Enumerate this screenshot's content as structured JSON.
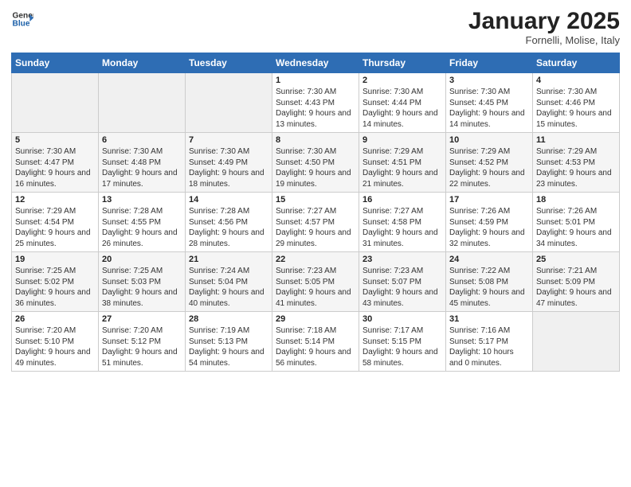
{
  "logo": {
    "line1": "General",
    "line2": "Blue"
  },
  "title": "January 2025",
  "location": "Fornelli, Molise, Italy",
  "days_of_week": [
    "Sunday",
    "Monday",
    "Tuesday",
    "Wednesday",
    "Thursday",
    "Friday",
    "Saturday"
  ],
  "weeks": [
    [
      {
        "day": "",
        "info": ""
      },
      {
        "day": "",
        "info": ""
      },
      {
        "day": "",
        "info": ""
      },
      {
        "day": "1",
        "info": "Sunrise: 7:30 AM\nSunset: 4:43 PM\nDaylight: 9 hours and 13 minutes."
      },
      {
        "day": "2",
        "info": "Sunrise: 7:30 AM\nSunset: 4:44 PM\nDaylight: 9 hours and 14 minutes."
      },
      {
        "day": "3",
        "info": "Sunrise: 7:30 AM\nSunset: 4:45 PM\nDaylight: 9 hours and 14 minutes."
      },
      {
        "day": "4",
        "info": "Sunrise: 7:30 AM\nSunset: 4:46 PM\nDaylight: 9 hours and 15 minutes."
      }
    ],
    [
      {
        "day": "5",
        "info": "Sunrise: 7:30 AM\nSunset: 4:47 PM\nDaylight: 9 hours and 16 minutes."
      },
      {
        "day": "6",
        "info": "Sunrise: 7:30 AM\nSunset: 4:48 PM\nDaylight: 9 hours and 17 minutes."
      },
      {
        "day": "7",
        "info": "Sunrise: 7:30 AM\nSunset: 4:49 PM\nDaylight: 9 hours and 18 minutes."
      },
      {
        "day": "8",
        "info": "Sunrise: 7:30 AM\nSunset: 4:50 PM\nDaylight: 9 hours and 19 minutes."
      },
      {
        "day": "9",
        "info": "Sunrise: 7:29 AM\nSunset: 4:51 PM\nDaylight: 9 hours and 21 minutes."
      },
      {
        "day": "10",
        "info": "Sunrise: 7:29 AM\nSunset: 4:52 PM\nDaylight: 9 hours and 22 minutes."
      },
      {
        "day": "11",
        "info": "Sunrise: 7:29 AM\nSunset: 4:53 PM\nDaylight: 9 hours and 23 minutes."
      }
    ],
    [
      {
        "day": "12",
        "info": "Sunrise: 7:29 AM\nSunset: 4:54 PM\nDaylight: 9 hours and 25 minutes."
      },
      {
        "day": "13",
        "info": "Sunrise: 7:28 AM\nSunset: 4:55 PM\nDaylight: 9 hours and 26 minutes."
      },
      {
        "day": "14",
        "info": "Sunrise: 7:28 AM\nSunset: 4:56 PM\nDaylight: 9 hours and 28 minutes."
      },
      {
        "day": "15",
        "info": "Sunrise: 7:27 AM\nSunset: 4:57 PM\nDaylight: 9 hours and 29 minutes."
      },
      {
        "day": "16",
        "info": "Sunrise: 7:27 AM\nSunset: 4:58 PM\nDaylight: 9 hours and 31 minutes."
      },
      {
        "day": "17",
        "info": "Sunrise: 7:26 AM\nSunset: 4:59 PM\nDaylight: 9 hours and 32 minutes."
      },
      {
        "day": "18",
        "info": "Sunrise: 7:26 AM\nSunset: 5:01 PM\nDaylight: 9 hours and 34 minutes."
      }
    ],
    [
      {
        "day": "19",
        "info": "Sunrise: 7:25 AM\nSunset: 5:02 PM\nDaylight: 9 hours and 36 minutes."
      },
      {
        "day": "20",
        "info": "Sunrise: 7:25 AM\nSunset: 5:03 PM\nDaylight: 9 hours and 38 minutes."
      },
      {
        "day": "21",
        "info": "Sunrise: 7:24 AM\nSunset: 5:04 PM\nDaylight: 9 hours and 40 minutes."
      },
      {
        "day": "22",
        "info": "Sunrise: 7:23 AM\nSunset: 5:05 PM\nDaylight: 9 hours and 41 minutes."
      },
      {
        "day": "23",
        "info": "Sunrise: 7:23 AM\nSunset: 5:07 PM\nDaylight: 9 hours and 43 minutes."
      },
      {
        "day": "24",
        "info": "Sunrise: 7:22 AM\nSunset: 5:08 PM\nDaylight: 9 hours and 45 minutes."
      },
      {
        "day": "25",
        "info": "Sunrise: 7:21 AM\nSunset: 5:09 PM\nDaylight: 9 hours and 47 minutes."
      }
    ],
    [
      {
        "day": "26",
        "info": "Sunrise: 7:20 AM\nSunset: 5:10 PM\nDaylight: 9 hours and 49 minutes."
      },
      {
        "day": "27",
        "info": "Sunrise: 7:20 AM\nSunset: 5:12 PM\nDaylight: 9 hours and 51 minutes."
      },
      {
        "day": "28",
        "info": "Sunrise: 7:19 AM\nSunset: 5:13 PM\nDaylight: 9 hours and 54 minutes."
      },
      {
        "day": "29",
        "info": "Sunrise: 7:18 AM\nSunset: 5:14 PM\nDaylight: 9 hours and 56 minutes."
      },
      {
        "day": "30",
        "info": "Sunrise: 7:17 AM\nSunset: 5:15 PM\nDaylight: 9 hours and 58 minutes."
      },
      {
        "day": "31",
        "info": "Sunrise: 7:16 AM\nSunset: 5:17 PM\nDaylight: 10 hours and 0 minutes."
      },
      {
        "day": "",
        "info": ""
      }
    ]
  ]
}
